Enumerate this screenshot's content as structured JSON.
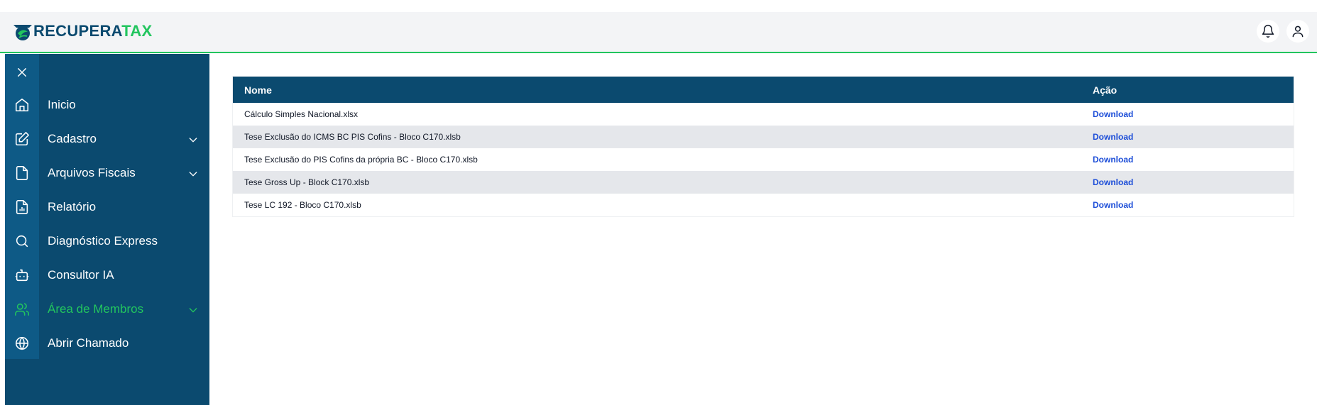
{
  "brand": {
    "part1": "RECUPERA",
    "part2": "TAX",
    "accent": "#22c55e",
    "primary": "#0b4a6f"
  },
  "header": {
    "icons": [
      "bell-icon",
      "user-icon"
    ]
  },
  "sidebar": {
    "items": [
      {
        "label": "Inicio",
        "icon": "home-icon"
      },
      {
        "label": "Cadastro",
        "icon": "edit-icon",
        "expandable": true
      },
      {
        "label": "Arquivos Fiscais",
        "icon": "file-icon",
        "expandable": true
      },
      {
        "label": "Relatório",
        "icon": "report-icon"
      },
      {
        "label": "Diagnóstico Express",
        "icon": "search-icon"
      },
      {
        "label": "Consultor IA",
        "icon": "bot-icon"
      },
      {
        "label": "Área de Membros",
        "icon": "users-icon",
        "expandable": true,
        "active": true
      },
      {
        "label": "Abrir Chamado",
        "icon": "globe-icon"
      }
    ]
  },
  "table": {
    "headers": {
      "name": "Nome",
      "action": "Ação"
    },
    "rows": [
      {
        "name": "Cálculo Simples Nacional.xlsx",
        "action": "Download"
      },
      {
        "name": "Tese Exclusão do ICMS BC PIS Cofins - Bloco C170.xlsb",
        "action": "Download"
      },
      {
        "name": "Tese Exclusão do PIS Cofins da própria BC - Bloco C170.xlsb",
        "action": "Download"
      },
      {
        "name": "Tese Gross Up - Block C170.xlsb",
        "action": "Download"
      },
      {
        "name": "Tese LC 192 - Bloco C170.xlsb",
        "action": "Download"
      }
    ]
  }
}
